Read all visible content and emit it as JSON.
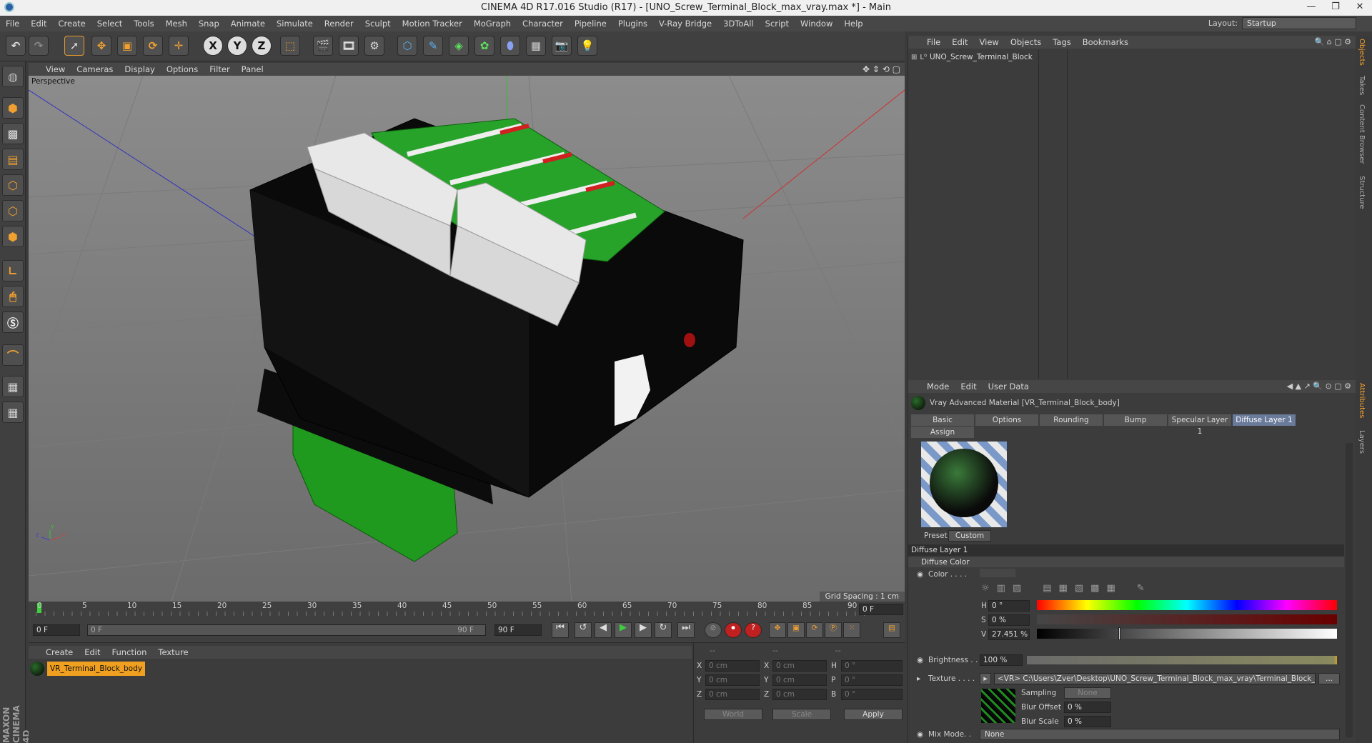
{
  "window": {
    "title": "CINEMA 4D R17.016 Studio (R17) - [UNO_Screw_Terminal_Block_max_vray.max *] - Main",
    "min": "—",
    "restore": "❐",
    "close": "✕"
  },
  "menu": [
    "File",
    "Edit",
    "Create",
    "Select",
    "Tools",
    "Mesh",
    "Snap",
    "Animate",
    "Simulate",
    "Render",
    "Sculpt",
    "Motion Tracker",
    "MoGraph",
    "Character",
    "Pipeline",
    "Plugins",
    "V-Ray Bridge",
    "3DToAll",
    "Script",
    "Window",
    "Help"
  ],
  "layout": {
    "label": "Layout:",
    "value": "Startup"
  },
  "toolbar": {
    "x": "X",
    "y": "Y",
    "z": "Z"
  },
  "viewport": {
    "menu": [
      "View",
      "Cameras",
      "Display",
      "Options",
      "Filter",
      "Panel"
    ],
    "label": "Perspective",
    "grid_spacing": "Grid Spacing : 1 cm",
    "axis_x": "x",
    "axis_y": "y",
    "axis_z": "z"
  },
  "timeline": {
    "ticks": [
      "0",
      "5",
      "10",
      "15",
      "20",
      "25",
      "30",
      "35",
      "40",
      "45",
      "50",
      "55",
      "60",
      "65",
      "70",
      "75",
      "80",
      "85",
      "90"
    ],
    "current": "0 F"
  },
  "transport": {
    "start": "0 F",
    "range_start": "0 F",
    "range_end": "90 F",
    "end": "90 F"
  },
  "matmgr": {
    "menu": [
      "Create",
      "Edit",
      "Function",
      "Texture"
    ],
    "material": "VR_Terminal_Block_body"
  },
  "coords": {
    "header": [
      "--",
      "--",
      "--"
    ],
    "rows": [
      {
        "a": "X",
        "av": "0 cm",
        "b": "X",
        "bv": "0 cm",
        "c": "H",
        "cv": "0 °"
      },
      {
        "a": "Y",
        "av": "0 cm",
        "b": "Y",
        "bv": "0 cm",
        "c": "P",
        "cv": "0 °"
      },
      {
        "a": "Z",
        "av": "0 cm",
        "b": "Z",
        "bv": "0 cm",
        "c": "B",
        "cv": "0 °"
      }
    ],
    "world": "World",
    "scale": "Scale",
    "apply": "Apply"
  },
  "objects": {
    "menu": [
      "File",
      "Edit",
      "View",
      "Objects",
      "Tags",
      "Bookmarks"
    ],
    "item": "UNO_Screw_Terminal_Block"
  },
  "attributes": {
    "menu": [
      "Mode",
      "Edit",
      "User Data"
    ],
    "title": "Vray Advanced Material [VR_Terminal_Block_body]",
    "tabs": [
      "Basic",
      "Options",
      "Rounding",
      "Bump",
      "Specular Layer 1",
      "Diffuse Layer 1"
    ],
    "assign": "Assign",
    "preset_label": "Preset",
    "preset_value": "Custom",
    "section": "Diffuse Layer 1",
    "subsection": "Diffuse Color",
    "color_label": "Color . . . .",
    "h_label": "H",
    "h": "0 °",
    "s_label": "S",
    "s": "0 %",
    "v_label": "V",
    "v": "27.451 %",
    "v_level": 0.27451,
    "brightness_label": "Brightness . .",
    "brightness": "100 %",
    "texture_label": "Texture . . . .",
    "texture_path": "<VR> C:\\Users\\Zver\\Desktop\\UNO_Screw_Terminal_Block_max_vray\\Terminal_Block_S",
    "more": "...",
    "sampling_label": "Sampling",
    "sampling": "None",
    "blur_offset_label": "Blur Offset",
    "blur_offset": "0 %",
    "blur_scale_label": "Blur Scale",
    "blur_scale": "0 %",
    "mix_label": "Mix Mode. .",
    "mix": "None"
  },
  "sidetabs": [
    "Objects",
    "Takes",
    "Content Browser",
    "Structure"
  ],
  "sidetabs2": [
    "Attributes",
    "Layers"
  ],
  "brand": "MAXON CINEMA 4D"
}
